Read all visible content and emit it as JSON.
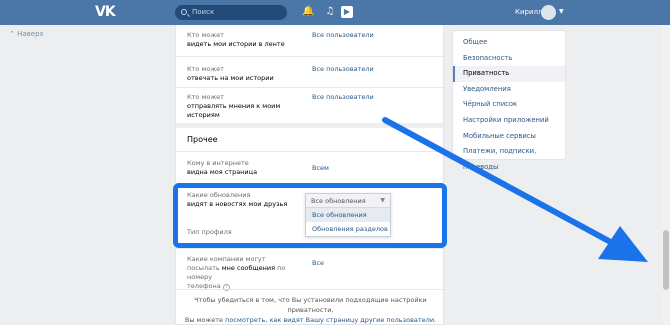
{
  "header": {
    "logo": "VK",
    "search_placeholder": "Поиск",
    "user_name": "Кирилл"
  },
  "back_link": "Наверх",
  "privacy": {
    "stories_rows": [
      {
        "label": "Кто может\nвидеть мои истории в ленте",
        "value": "Все пользователи"
      },
      {
        "label": "Кто может\nотвечать на мои истории",
        "value": "Все пользователи"
      },
      {
        "label": "Кто может\nотправлять мнения к моим историям",
        "value": "Все пользователи"
      }
    ],
    "other_title": "Прочее",
    "internet_row": {
      "label_a": "Кому в интернете",
      "label_b": "видна моя страница",
      "value": "Всем"
    },
    "updates_row": {
      "label_a": "Какие обновления",
      "label_b": "видят в новостях мои друзья"
    },
    "profile_type_label": "Тип профиля",
    "companies_row": {
      "label_a": "Какие компании могут",
      "label_b_pre": "посылать ",
      "label_b_bold": "мне сообщения",
      "label_b_post": " по номеру",
      "label_c": "телефона",
      "value": "Все"
    },
    "dropdown": {
      "selected": "Все обновления",
      "options": [
        "Все обновления",
        "Обновления разделов"
      ]
    },
    "footer_line1": "Чтобы убедиться в том, что Вы установили подходящие настройки приватности,",
    "footer_line2_pre": "Вы можете ",
    "footer_line2_link": "посмотреть, как видят Вашу страницу другие пользователи",
    "footer_line2_post": "."
  },
  "menu": {
    "items": [
      "Общее",
      "Безопасность",
      "Приватность",
      "Уведомления",
      "Чёрный список",
      "Настройки приложений",
      "Мобильные сервисы",
      "Платежи, подписки, переводы"
    ],
    "active_index": 2
  },
  "colors": {
    "header": "#4a76a8",
    "link": "#2a5885",
    "highlight": "#1a73e8"
  }
}
